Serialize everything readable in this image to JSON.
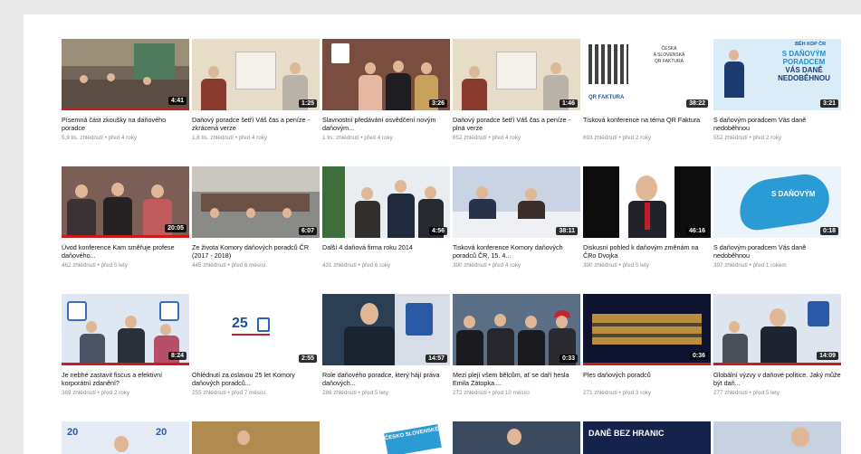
{
  "videos": [
    {
      "title": "Písemná část zkoušky na daňového poradce",
      "meta": "5,9 tis. zhlédnutí • před 4 roky",
      "duration": "4:41",
      "progress": 1.0
    },
    {
      "title": "Daňový poradce šetří Váš čas a peníze - zkrácená verze",
      "meta": "1,6 tis. zhlédnutí • před 4 roky",
      "duration": "1:25",
      "progress": 0
    },
    {
      "title": "Slavnostní předávání osvědčení novým daňovým...",
      "meta": "1 tis. zhlédnutí • před 4 roky",
      "duration": "3:26",
      "progress": 0
    },
    {
      "title": "Daňový poradce šetří Váš čas a peníze - plná verze",
      "meta": "852 zhlédnutí • před 4 roky",
      "duration": "1:46",
      "progress": 0
    },
    {
      "title": "Tisková konference na téma QR Faktura",
      "meta": "693 zhlédnutí • před 2 roky",
      "duration": "38:22",
      "progress": 0
    },
    {
      "title": "S daňovým poradcem Vás daně nedoběhnou",
      "meta": "552 zhlédnutí • před 2 roky",
      "duration": "3:21",
      "progress": 0
    },
    {
      "title": "Úvod konference Kam směřuje profese daňového...",
      "meta": "462 zhlédnutí • před 5 lety",
      "duration": "20:05",
      "progress": 1.0
    },
    {
      "title": "Ze života Komory daňových poradců ČR (2017 - 2018)",
      "meta": "445 zhlédnutí • před 6 měsíci",
      "duration": "6:07",
      "progress": 0
    },
    {
      "title": "Další 4 daňová firma roku 2014",
      "meta": "431 zhlédnutí • před 6 roky",
      "duration": "4:56",
      "progress": 0
    },
    {
      "title": "Tisková konference Komory daňových poradců ČR, 15. 4...",
      "meta": "390 zhlédnutí • před 4 roky",
      "duration": "38:11",
      "progress": 0
    },
    {
      "title": "Diskusní pohled k daňovým změnám na ČRo Dvojka",
      "meta": "390 zhlédnutí • před 5 lety",
      "duration": "46:16",
      "progress": 0
    },
    {
      "title": "S daňovým poradcem Vás daně nedoběhnou",
      "meta": "397 zhlédnutí • před 1 rokem",
      "duration": "0:18",
      "progress": 0
    },
    {
      "title": "Je nebhé zastavit fiscus a efektivní korporátní zdanění?",
      "meta": "369 zhlédnutí • před 2 roky",
      "duration": "8:24",
      "progress": 1.0
    },
    {
      "title": "Ohlédnutí za oslavou 25 let Komory daňových poradců...",
      "meta": "255 zhlédnutí • před 7 měsíci",
      "duration": "2:55",
      "progress": 0
    },
    {
      "title": "Role daňového poradce, který hájí práva daňových...",
      "meta": "286 zhlédnutí • před 5 lety",
      "duration": "14:57",
      "progress": 0
    },
    {
      "title": "Mezi plejí všem bělcům, ať se daří hesla Emila Zátopka ...",
      "meta": "272 zhlédnutí • před 10 měsíci",
      "duration": "0:33",
      "progress": 0
    },
    {
      "title": "Ples daňových poradců",
      "meta": "271 zhlédnutí • před 3 roky",
      "duration": "0:36",
      "progress": 1.0
    },
    {
      "title": "Globální výzvy v daňové politice. Jaký může být daň...",
      "meta": "277 zhlédnutí • před 5 lety",
      "duration": "14:09",
      "progress": 1.0
    }
  ],
  "row4": [
    {
      "label": "20",
      "label2": "20"
    },
    {},
    {
      "label": "ČESKO SLOVENSKÉ"
    },
    {},
    {
      "label": "DANĚ BEZ HRANIC"
    },
    {}
  ],
  "thumb_text": {
    "qr_text": "QR FAKTURA",
    "run_title": "BĚH KDP ČR",
    "run_line1": "S DAŇOVÝM",
    "run_line2": "PORADCEM",
    "run_line3": "VÁS DANĚ",
    "run_line4": "NEDOBĚHNOU",
    "logo25": "25"
  },
  "colors": {
    "progress": "#cc1b1b",
    "page_bg": "#ffffff",
    "outer_bg": "#e9e9e9"
  }
}
